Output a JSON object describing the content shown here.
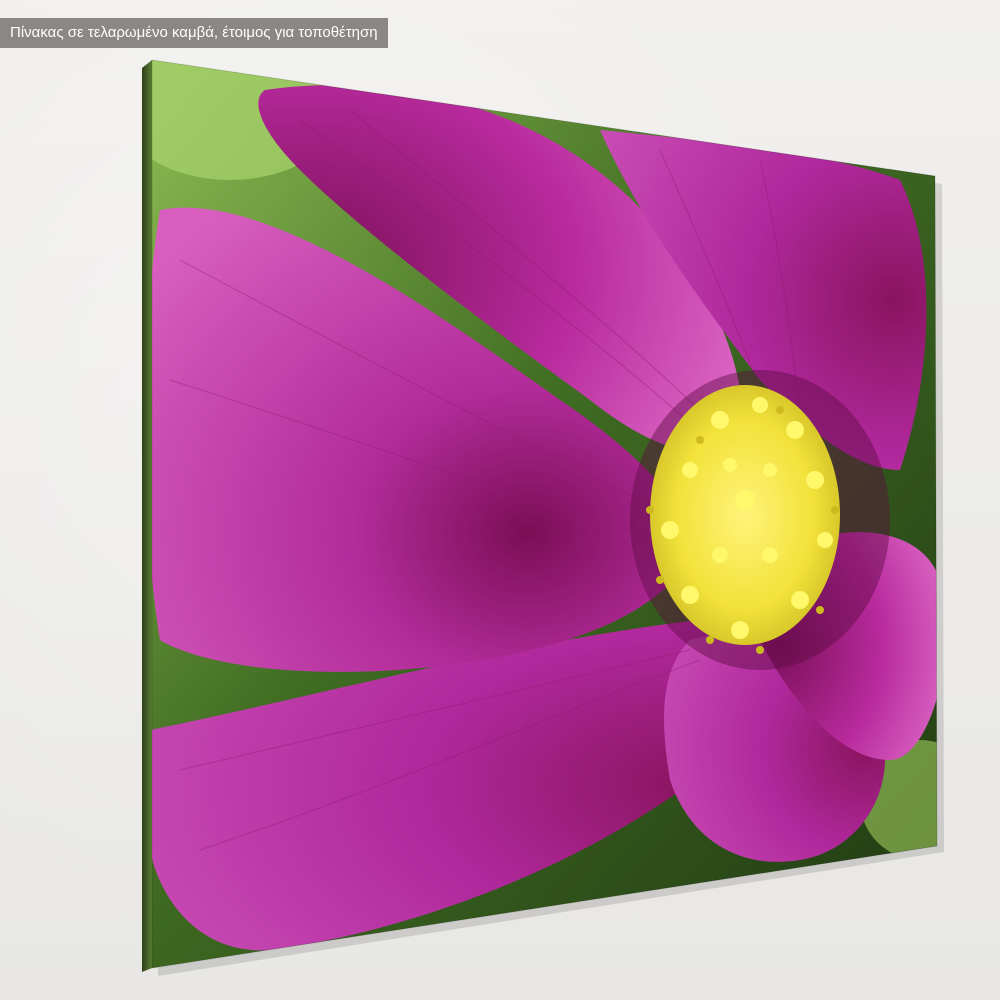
{
  "banner": {
    "text": "Πίνακας σε τελαρωμένο καμβά,  έτοιμος για τοποθέτηση"
  },
  "artwork": {
    "subject": "pink cosmos flower close-up",
    "colors": {
      "petal": "#b0279a",
      "petal_light": "#d24fb8",
      "petal_dark": "#7d145e",
      "center": "#f0e53a",
      "background": "#4f7a2a",
      "wall": "#eeedeb"
    }
  }
}
